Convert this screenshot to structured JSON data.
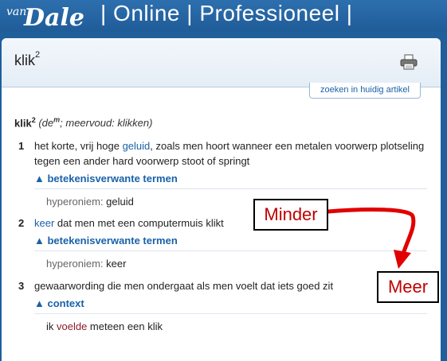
{
  "header": {
    "logo_text": "van Dale",
    "title": "| Online | Professioneel |"
  },
  "article": {
    "title": "klik",
    "title_sup": "2",
    "search_tab": "zoeken in huidig artikel",
    "headword": "klik",
    "headword_sup": "2",
    "gram_open": "(de",
    "gram_sup": "m",
    "gram_mid": "; meervoud: ",
    "gram_plural": "klikken",
    "gram_close": ")"
  },
  "senses": [
    {
      "num": "1",
      "pre": "het korte, vrij hoge ",
      "link": "geluid",
      "post": ", zoals men hoort wanneer een metalen voorwerp plotseling tegen een ander hard voorwerp stoot of springt",
      "section": "▲ betekenisverwante termen",
      "rel_label": "hyperoniem: ",
      "rel_value": "geluid"
    },
    {
      "num": "2",
      "link": "keer",
      "post": " dat men met een computermuis klikt",
      "section": "▲ betekenisverwante termen",
      "rel_label": "hyperoniem: ",
      "rel_value": "keer"
    },
    {
      "num": "3",
      "text": "gewaarwording die men ondergaat als men voelt dat iets goed zit",
      "section": "▲ context",
      "ex_pre": "ik ",
      "ex_link": "voelde",
      "ex_post": " meteen een klik"
    }
  ],
  "annotations": {
    "minder": "Minder",
    "meer": "Meer"
  },
  "colors": {
    "header_bg": "#1e5f9c",
    "link": "#1a62a8",
    "annotation": "#c00000"
  }
}
